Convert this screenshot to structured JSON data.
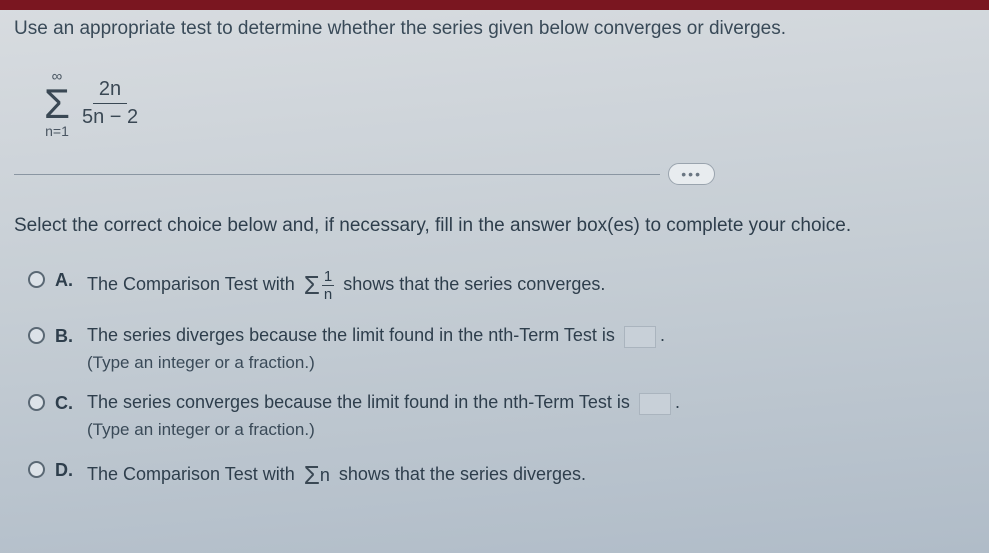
{
  "question": "Use an appropriate test to determine whether the series given below converges or diverges.",
  "formula": {
    "upper": "∞",
    "lower": "n=1",
    "numerator": "2n",
    "denominator": "5n − 2"
  },
  "ellipsis": "•••",
  "instruction": "Select the correct choice below and, if necessary, fill in the answer box(es) to complete your choice.",
  "options": {
    "a": {
      "letter": "A.",
      "pre": "The Comparison Test with",
      "frac_num": "1",
      "frac_den": "n",
      "post": "shows that the series converges."
    },
    "b": {
      "letter": "B.",
      "text": "The series diverges because the limit found in the nth-Term Test is",
      "hint": "(Type an integer or a fraction.)"
    },
    "c": {
      "letter": "C.",
      "text": "The series converges because the limit found in the nth-Term Test is",
      "hint": "(Type an integer or a fraction.)"
    },
    "d": {
      "letter": "D.",
      "pre": "The Comparison Test with",
      "term": "n",
      "post": "shows that the series diverges."
    }
  }
}
